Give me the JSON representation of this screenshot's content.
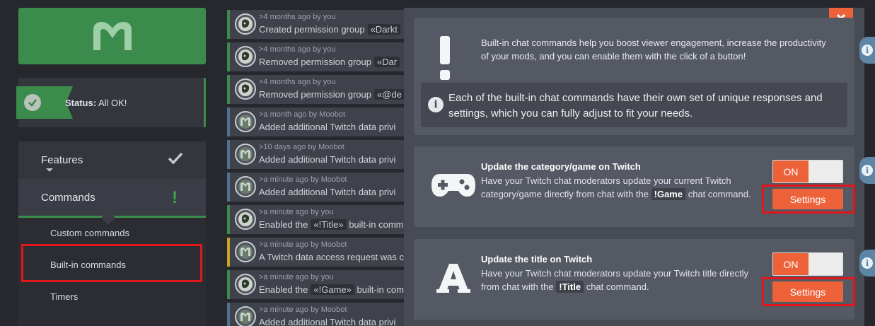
{
  "sidebar": {
    "status_label": "Status:",
    "status_value": "All OK!",
    "nav": {
      "features": "Features",
      "commands": "Commands",
      "sub_items": [
        "Custom commands",
        "Built-in commands",
        "Timers"
      ]
    }
  },
  "feed": [
    {
      "meta": ">4 months ago by you",
      "text": "Created permission group",
      "code": "«Darkt",
      "avatar": "user-avatar-icon",
      "color": "green"
    },
    {
      "meta": ">4 months ago by you",
      "text": "Removed permission group",
      "code": "«Dar",
      "avatar": "user-avatar-icon",
      "color": "green"
    },
    {
      "meta": ">4 months ago by you",
      "text": "Removed permission group",
      "code": "«@de",
      "avatar": "user-avatar-icon",
      "color": "green"
    },
    {
      "meta": ">a month ago by Moobot",
      "text": "Added additional Twitch data privi",
      "code": "",
      "avatar": "moobot-avatar-icon",
      "color": "blue"
    },
    {
      "meta": ">10 days ago by Moobot",
      "text": "Added additional Twitch data privi",
      "code": "",
      "avatar": "moobot-avatar-icon",
      "color": "blue"
    },
    {
      "meta": ">a minute ago by Moobot",
      "text": "Added additional Twitch data privi",
      "code": "",
      "avatar": "moobot-avatar-icon",
      "color": "blue"
    },
    {
      "meta": ">a minute ago by you",
      "text": "Enabled the",
      "code": "«!Title»",
      "tail": "built-in comm",
      "avatar": "user-avatar-icon",
      "color": "green"
    },
    {
      "meta": ">a minute ago by Moobot",
      "text": "A Twitch data access request was c",
      "code": "",
      "avatar": "moobot-avatar-icon",
      "color": "gold"
    },
    {
      "meta": ">a minute ago by you",
      "text": "Enabled the",
      "code": "«!Game»",
      "tail": "built-in com",
      "avatar": "user-avatar-icon",
      "color": "green"
    },
    {
      "meta": ">a minute ago by Moobot",
      "text": "Added additional Twitch data privi",
      "code": "",
      "avatar": "moobot-avatar-icon",
      "color": "blue"
    }
  ],
  "modal": {
    "intro_text": "Built-in chat commands help you boost viewer engagement, increase the productivity of your mods, and you can enable them with the click of a button!",
    "note_text": "Each of the built-in chat commands have their own set of unique responses and settings, which you can fully adjust to fit your needs.",
    "features": [
      {
        "title": "Update the category/game on Twitch",
        "desc_before": "Have your Twitch chat moderators update your current Twitch category/game directly from chat with the",
        "command": "!Game",
        "desc_after": "chat command.",
        "toggle": "ON",
        "settings": "Settings",
        "icon": "gamepad-icon"
      },
      {
        "title": "Update the title on Twitch",
        "desc_before": "Have your Twitch chat moderators update your Twitch title directly from chat with the",
        "command": "!Title",
        "desc_after": "chat command.",
        "toggle": "ON",
        "settings": "Settings",
        "icon": "letter-a-icon"
      }
    ]
  },
  "colors": {
    "accent": "#ee6239",
    "brand_green": "#3b8c4c",
    "highlight_red": "#e0161b",
    "info_blue": "#5d86a6"
  }
}
